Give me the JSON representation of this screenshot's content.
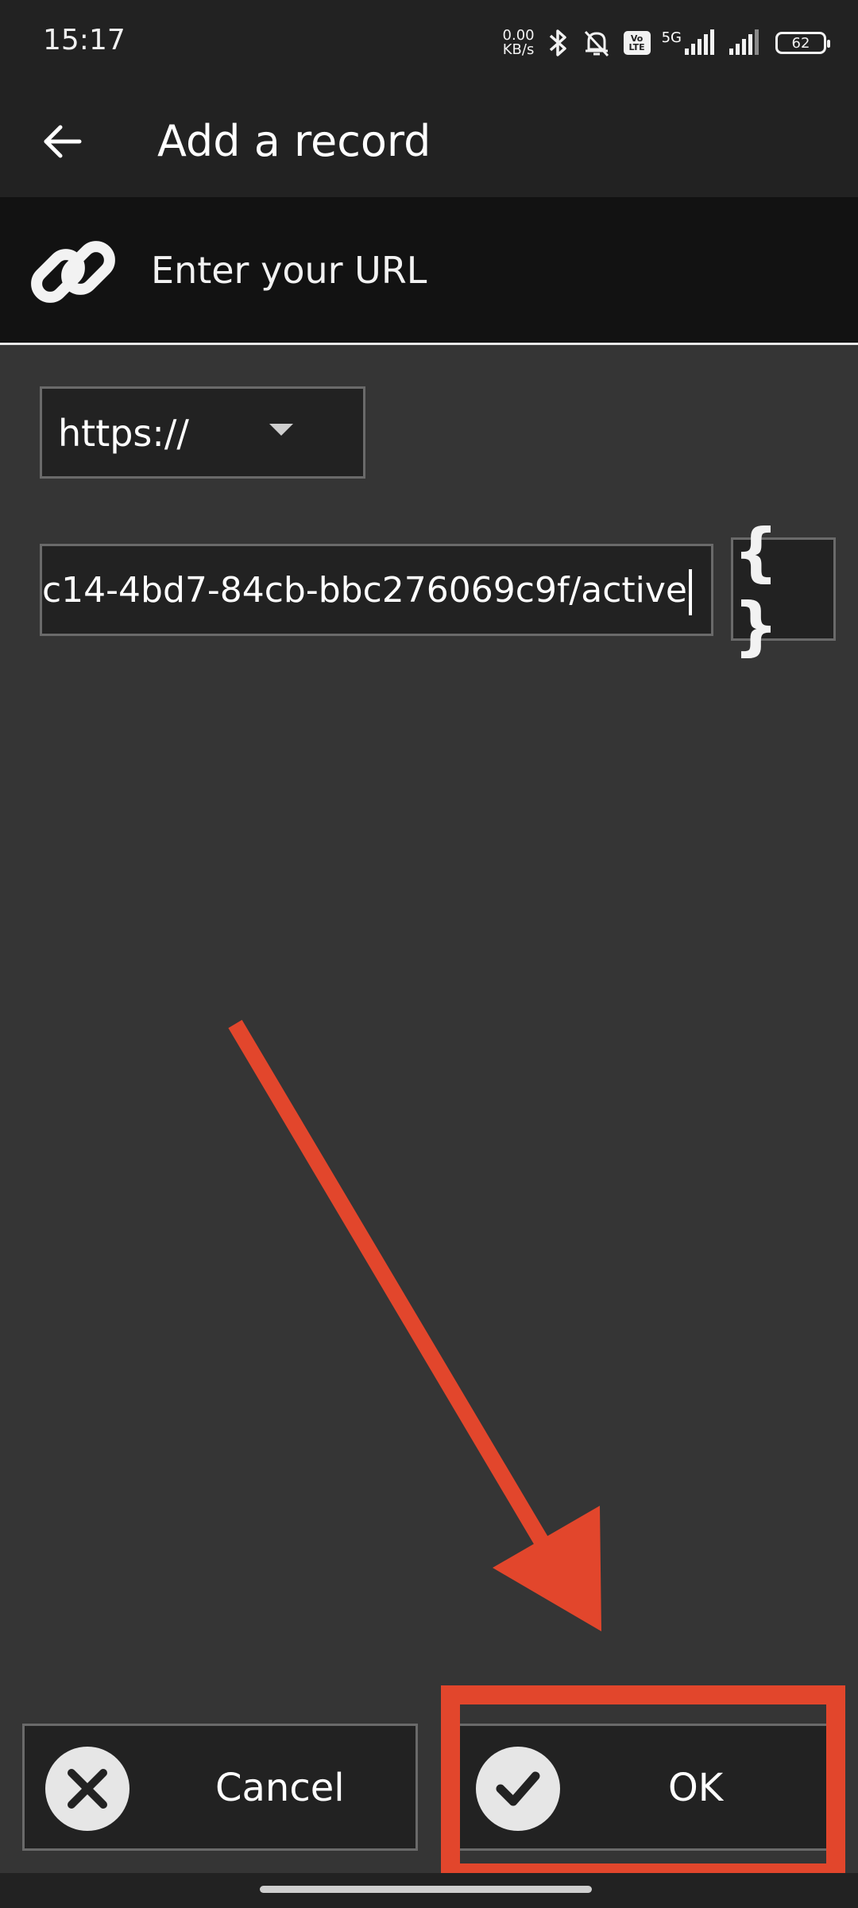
{
  "status_bar": {
    "time": "15:17",
    "net_speed_value": "0.00",
    "net_speed_unit": "KB/s",
    "network_type": "5G",
    "volte_top": "Vo",
    "volte_bottom": "LTE",
    "battery_level": "62",
    "icons": [
      "bluetooth-icon",
      "mute-icon",
      "signal-icon",
      "signal-icon"
    ]
  },
  "app_bar": {
    "title": "Add a record",
    "back_icon": "arrow-left-icon"
  },
  "section": {
    "label": "Enter your URL",
    "icon": "link-icon"
  },
  "scheme_select": {
    "value": "https://"
  },
  "url_field": {
    "value": "c14-4bd7-84cb-bbc276069c9f/active"
  },
  "braces_button": {
    "label": "{ }"
  },
  "buttons": {
    "cancel_label": "Cancel",
    "ok_label": "OK"
  },
  "colors": {
    "background": "#353535",
    "bar": "#222222",
    "header": "#121212",
    "annotation": "#e2462c"
  }
}
